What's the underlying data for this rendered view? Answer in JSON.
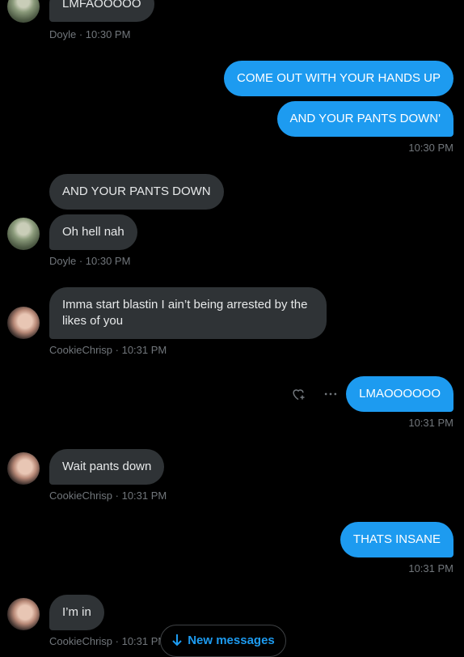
{
  "messages": [
    {
      "text": "LMFAOOOOO"
    },
    {
      "text": "COME OUT WITH YOUR HANDS UP"
    },
    {
      "text": "AND YOUR PANTS DOWN'"
    },
    {
      "text": "AND YOUR PANTS DOWN"
    },
    {
      "text": "Oh hell nah"
    },
    {
      "text": "Imma start blastin I ain’t being arrested by the likes of you"
    },
    {
      "text": "LMAOOOOOO"
    },
    {
      "text": "Wait pants down"
    },
    {
      "text": "THATS INSANE"
    },
    {
      "text": "I’m in"
    }
  ],
  "meta": {
    "m1": "Doyle · 10:30 PM",
    "m2": "10:30 PM",
    "m3": "Doyle · 10:30 PM",
    "m4": "CookieChrisp · 10:31 PM",
    "m5": "10:31 PM",
    "m6": "CookieChrisp · 10:31 PM",
    "m7": "10:31 PM",
    "m8": "CookieChrisp · 10:31 PM"
  },
  "new_messages_label": "New messages",
  "colors": {
    "outgoing": "#1d9bf0",
    "incoming": "#2f3336",
    "meta": "#71767b"
  },
  "icons": {
    "react": "heart-plus-icon",
    "more": "more-horizontal-icon",
    "new": "arrow-down-icon"
  }
}
